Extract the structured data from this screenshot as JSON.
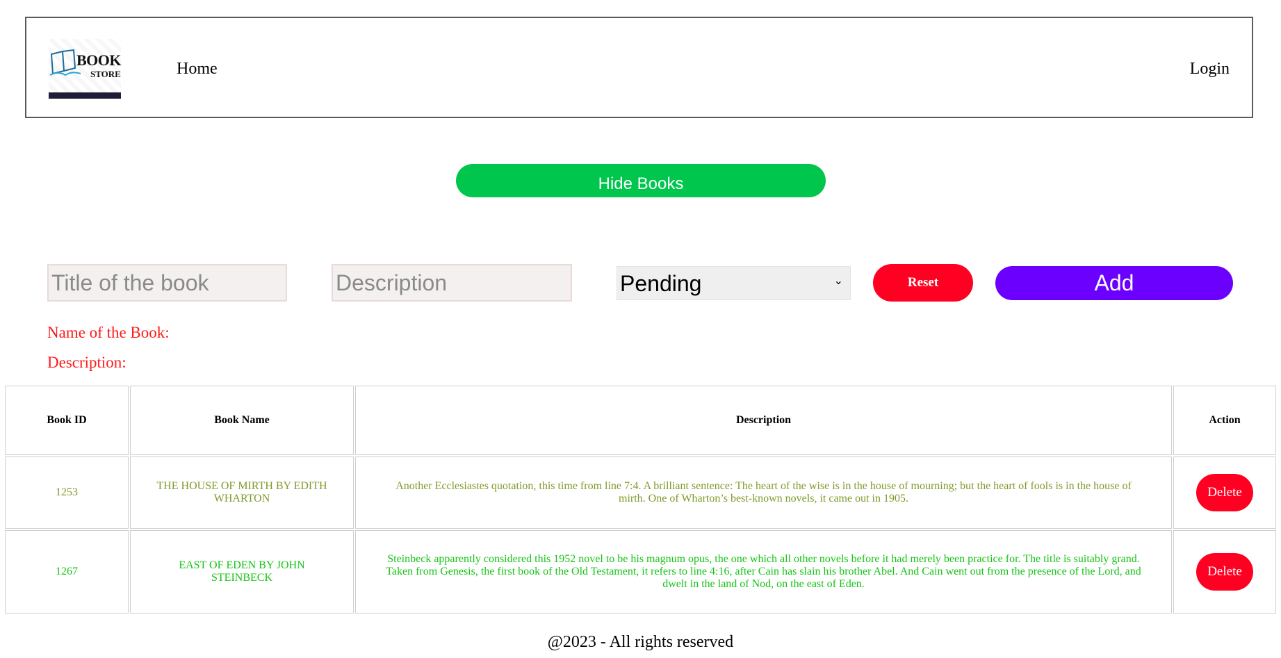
{
  "header": {
    "logo": {
      "line1": "BOOK",
      "line2": "STORE"
    },
    "nav_home": "Home",
    "nav_login": "Login"
  },
  "toggle": {
    "label": "Hide Books",
    "color": "#00c64e"
  },
  "form": {
    "title_placeholder": "Title of the book",
    "description_placeholder": "Description",
    "status_selected": "Pending",
    "reset_label": "Reset",
    "add_label": "Add"
  },
  "preview": {
    "name_label": "Name of the Book:",
    "description_label": "Description:"
  },
  "table": {
    "headers": {
      "id": "Book ID",
      "name": "Book Name",
      "description": "Description",
      "action": "Action"
    },
    "rows": [
      {
        "id": "1253",
        "name": "THE HOUSE OF MIRTH BY EDITH WHARTON",
        "description": "Another Ecclesiastes quotation, this time from line 7:4. A brilliant sentence: The heart of the wise is in the house of mourning; but the heart of fools is in the house of mirth. One of Wharton’s best-known novels, it came out in 1905.",
        "action": "Delete",
        "color": "#7f9a2a"
      },
      {
        "id": "1267",
        "name": "EAST OF EDEN BY JOHN STEINBECK",
        "description": "Steinbeck apparently considered this 1952 novel to be his magnum opus, the one which all other novels before it had merely been practice for. The title is suitably grand. Taken from Genesis, the first book of the Old Testament, it refers to line 4:16, after Cain has slain his brother Abel. And Cain went out from the presence of the Lord, and dwelt in the land of Nod, on the east of Eden.",
        "action": "Delete",
        "color": "#15c415"
      }
    ]
  },
  "footer": {
    "text": "@2023 - All rights reserved"
  }
}
